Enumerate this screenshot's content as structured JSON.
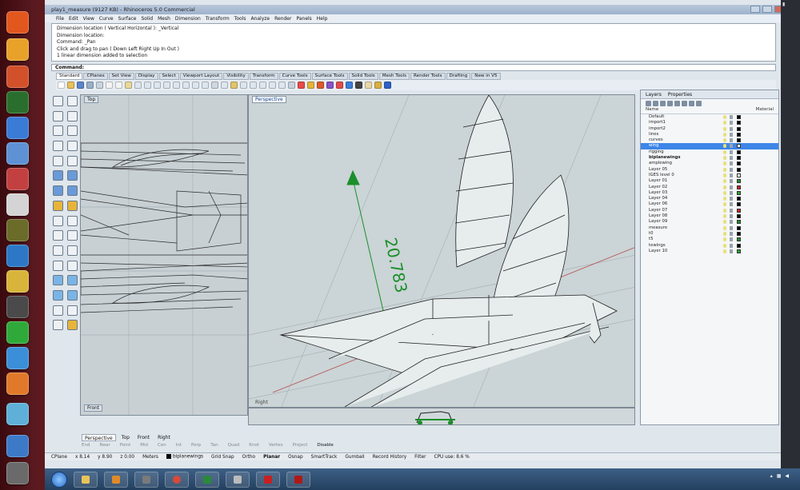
{
  "window": {
    "title": "play1_measure (9127 KB) - Rhinoceros 5.0 Commercial"
  },
  "menu": [
    "File",
    "Edit",
    "View",
    "Curve",
    "Surface",
    "Solid",
    "Mesh",
    "Dimension",
    "Transform",
    "Tools",
    "Analyze",
    "Render",
    "Panels",
    "Help"
  ],
  "command_history": [
    "Dimension location ( Vertical  Horizontal ): _Vertical",
    "Dimension location:",
    "Command: _Pan",
    "Click and drag to pan ( Down  Left  Right  Up  In  Out )",
    "1 linear dimension added to selection"
  ],
  "command": {
    "label": "Command:",
    "value": ""
  },
  "toolbar_tabs": [
    "Standard",
    "CPlanes",
    "Set View",
    "Display",
    "Select",
    "Viewport Layout",
    "Visibility",
    "Transform",
    "Curve Tools",
    "Surface Tools",
    "Solid Tools",
    "Mesh Tools",
    "Render Tools",
    "Drafting",
    "New in V5"
  ],
  "viewports": {
    "top": {
      "label": "Top"
    },
    "perspective": {
      "label": "Perspective",
      "dimension_text": "20.783"
    },
    "front": {
      "label": "Front"
    },
    "right": {
      "label": "Right"
    }
  },
  "viewport_tabs": [
    "Perspective",
    "Top",
    "Front",
    "Right"
  ],
  "layers_panel": {
    "tabs": [
      "Layers",
      "Properties"
    ],
    "col_name": "Name",
    "col_material": "Material",
    "rows": [
      {
        "name": "Default",
        "color": "#000000",
        "state": "normal"
      },
      {
        "name": "import1",
        "color": "#000000",
        "state": "normal"
      },
      {
        "name": "import2",
        "color": "#000000",
        "state": "normal"
      },
      {
        "name": "lines",
        "color": "#000000",
        "state": "normal"
      },
      {
        "name": "curves",
        "color": "#000000",
        "state": "normal"
      },
      {
        "name": "wing",
        "color": "#ffffff",
        "state": "selected"
      },
      {
        "name": "rigging",
        "color": "#000000",
        "state": "normal"
      },
      {
        "name": "biplanewings",
        "color": "#000000",
        "state": "bold"
      },
      {
        "name": "amplewing",
        "color": "#000000",
        "state": "normal"
      },
      {
        "name": "Layer 05",
        "color": "#000000",
        "state": "normal"
      },
      {
        "name": "IGES level 0",
        "color": "#ffffff",
        "state": "normal"
      },
      {
        "name": "Layer 01",
        "color": "#1c8f2a",
        "state": "normal"
      },
      {
        "name": "Layer 02",
        "color": "#c82020",
        "state": "normal"
      },
      {
        "name": "Layer 03",
        "color": "#2aa82a",
        "state": "normal"
      },
      {
        "name": "Layer 04",
        "color": "#000000",
        "state": "normal"
      },
      {
        "name": "Layer 06",
        "color": "#000000",
        "state": "normal"
      },
      {
        "name": "Layer 07",
        "color": "#c82020",
        "state": "normal"
      },
      {
        "name": "Layer 08",
        "color": "#000000",
        "state": "normal"
      },
      {
        "name": "Layer 09",
        "color": "#1c8f2a",
        "state": "normal"
      },
      {
        "name": "measure",
        "color": "#000000",
        "state": "normal"
      },
      {
        "name": "t0",
        "color": "#000000",
        "state": "normal"
      },
      {
        "name": "t5",
        "color": "#1c8f2a",
        "state": "normal"
      },
      {
        "name": "tewings",
        "color": "#000000",
        "state": "normal"
      },
      {
        "name": "Layer 10",
        "color": "#2aa82a",
        "state": "normal"
      }
    ]
  },
  "osnap": [
    "End",
    "Near",
    "Point",
    "Mid",
    "Cen",
    "Int",
    "Perp",
    "Tan",
    "Quad",
    "Knot",
    "Vertex",
    "Project",
    "Disable"
  ],
  "status": {
    "cplane": "CPlane",
    "x": "x 8.14",
    "y": "y 8.90",
    "z": "z 0.00",
    "units": "Meters",
    "layer": "biplanewings",
    "grid_snap": "Grid Snap",
    "ortho": "Ortho",
    "planar": "Planar",
    "osnap": "Osnap",
    "smarttrack": "SmartTrack",
    "gumball": "Gumball",
    "record_history": "Record History",
    "filter": "Filter",
    "cpu": "CPU use: 8.6 %"
  },
  "colors": {
    "accent": "#3d86e8",
    "dimension_green": "#1a8f2a",
    "viewport_bg": "#c8d0d4"
  }
}
